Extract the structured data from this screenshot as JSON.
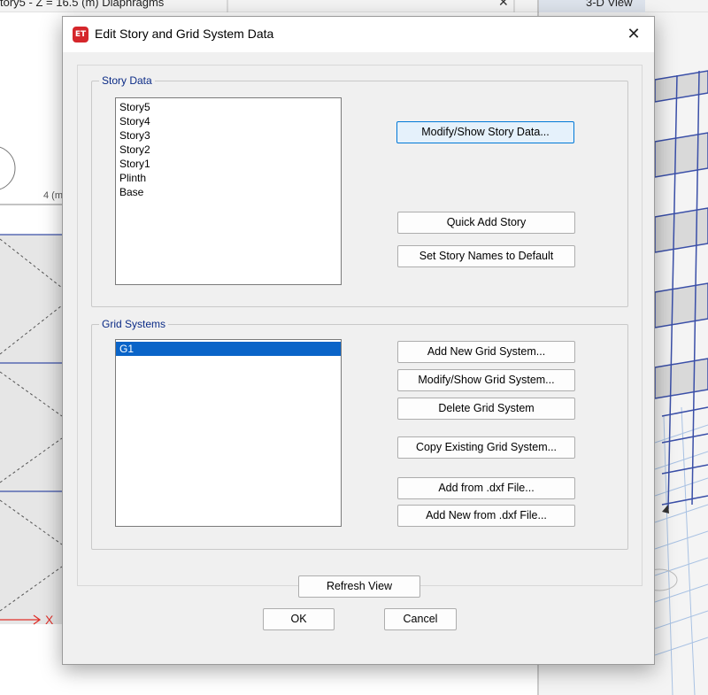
{
  "background": {
    "title_left": "tory5 - Z = 16.5 (m)  Diaphragms",
    "title_right": "3-D View",
    "close_glyph": "✕",
    "dim_label": "4 (m",
    "axis_marker": "X"
  },
  "dialog": {
    "icon_text": "ET",
    "title": "Edit Story and Grid System Data",
    "close_glyph": "✕"
  },
  "story_data": {
    "legend": "Story Data",
    "stories": [
      "Story5",
      "Story4",
      "Story3",
      "Story2",
      "Story1",
      "Plinth",
      "Base"
    ],
    "buttons": {
      "modify_show": "Modify/Show Story Data...",
      "quick_add": "Quick Add Story",
      "set_default": "Set Story Names to Default"
    }
  },
  "grid_systems": {
    "legend": "Grid Systems",
    "grids": [
      "G1"
    ],
    "buttons": {
      "add_new": "Add New Grid System...",
      "modify_show": "Modify/Show Grid System...",
      "delete": "Delete Grid System",
      "copy_existing": "Copy Existing Grid System...",
      "add_from_dxf": "Add  from .dxf File...",
      "add_new_from_dxf": "Add New from .dxf File..."
    }
  },
  "footer": {
    "refresh": "Refresh View",
    "ok": "OK",
    "cancel": "Cancel"
  },
  "colors": {
    "selection": "#0a64c8",
    "legend_text": "#0b2b86",
    "model_lines": "#3a4fa8",
    "app_icon": "#d5262b"
  }
}
